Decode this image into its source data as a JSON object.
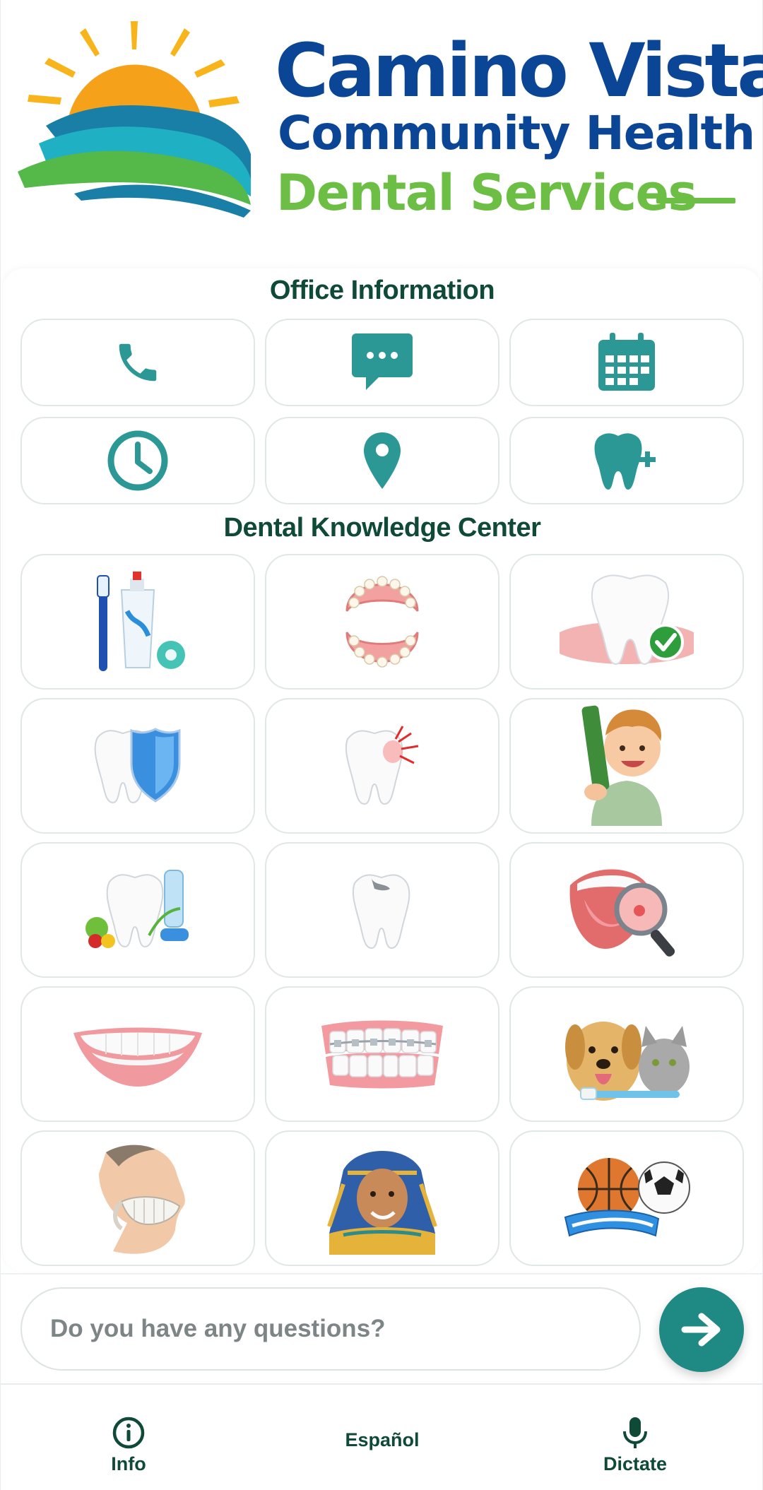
{
  "brand": {
    "line1": "Camino Vista",
    "line2": "Community Health",
    "line3": "Dental Services"
  },
  "office_section": {
    "title": "Office Information",
    "tiles": [
      {
        "icon": "phone-icon"
      },
      {
        "icon": "chat-bubble-icon"
      },
      {
        "icon": "calendar-icon"
      },
      {
        "icon": "clock-icon"
      },
      {
        "icon": "location-pin-icon"
      },
      {
        "icon": "tooth-plus-icon"
      }
    ]
  },
  "knowledge_section": {
    "title": "Dental Knowledge Center",
    "tiles": [
      {
        "icon": "toothbrush-toothpaste-floss-icon"
      },
      {
        "icon": "dental-arches-icon"
      },
      {
        "icon": "healthy-tooth-checkmark-icon"
      },
      {
        "icon": "tooth-shield-icon"
      },
      {
        "icon": "tooth-pain-icon"
      },
      {
        "icon": "child-with-toothbrush-icon"
      },
      {
        "icon": "tooth-nutrition-icon"
      },
      {
        "icon": "tooth-cavity-icon"
      },
      {
        "icon": "mouth-magnifier-icon"
      },
      {
        "icon": "white-smile-icon"
      },
      {
        "icon": "braces-icon"
      },
      {
        "icon": "pet-dental-icon"
      },
      {
        "icon": "jaw-profile-icon"
      },
      {
        "icon": "pharaoh-icon"
      },
      {
        "icon": "sports-mouthguard-icon"
      }
    ]
  },
  "chat": {
    "placeholder": "Do you have any questions?"
  },
  "nav": {
    "info_label": "Info",
    "language_label": "Español",
    "dictate_label": "Dictate"
  },
  "colors": {
    "brand_blue": "#0b4596",
    "brand_green": "#6cbf44",
    "teal_icon": "#2b9896",
    "heading_green": "#0f4a36",
    "send_button": "#1e8a83"
  }
}
